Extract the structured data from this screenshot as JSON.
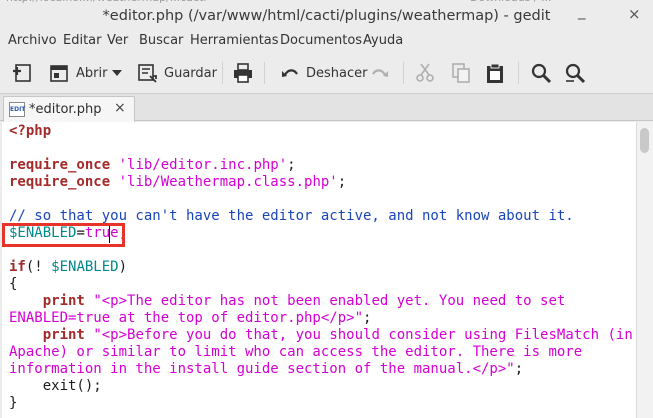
{
  "window": {
    "title": "*editor.php (/var/www/html/cacti/plugins/weathermap) - gedit",
    "minimize": "_",
    "close": "×"
  },
  "menubar": {
    "items": [
      "Archivo",
      "Editar",
      "Ver",
      "Buscar",
      "Herramientas",
      "Documentos",
      "Ayuda"
    ]
  },
  "toolbar": {
    "open_label": "Abrir",
    "save_label": "Guardar",
    "undo_label": "Deshacer"
  },
  "tab": {
    "label": "*editor.php",
    "icon_text": "EDIT",
    "close": "×"
  },
  "editor": {
    "lines": [
      [
        {
          "t": "<?php",
          "c": "kw"
        }
      ],
      [],
      [
        {
          "t": "require_once",
          "c": "kw"
        },
        {
          "t": " ",
          "c": "txt"
        },
        {
          "t": "'lib/editor.inc.php'",
          "c": "str"
        },
        {
          "t": ";",
          "c": "txt"
        }
      ],
      [
        {
          "t": "require_once",
          "c": "kw"
        },
        {
          "t": " ",
          "c": "txt"
        },
        {
          "t": "'lib/Weathermap.class.php'",
          "c": "str"
        },
        {
          "t": ";",
          "c": "txt"
        }
      ],
      [],
      [
        {
          "t": "// so that you can't have the editor active, and not know about it.",
          "c": "cmt"
        }
      ],
      [
        {
          "t": "$ENABLED",
          "c": "var"
        },
        {
          "t": "=",
          "c": "txt"
        },
        {
          "t": "true",
          "c": "str"
        },
        {
          "t": ";",
          "c": "txt"
        }
      ],
      [],
      [
        {
          "t": "if",
          "c": "kw"
        },
        {
          "t": "(! ",
          "c": "txt"
        },
        {
          "t": "$ENABLED",
          "c": "var"
        },
        {
          "t": ")",
          "c": "txt"
        }
      ],
      [
        {
          "t": "{",
          "c": "txt"
        }
      ],
      [
        {
          "t": "    ",
          "c": "txt"
        },
        {
          "t": "print",
          "c": "kw"
        },
        {
          "t": " ",
          "c": "txt"
        },
        {
          "t": "\"<p>The editor has not been enabled yet. You need to set",
          "c": "str"
        }
      ],
      [
        {
          "t": "ENABLED=true at the top of editor.php</p>\"",
          "c": "str"
        },
        {
          "t": ";",
          "c": "txt"
        }
      ],
      [
        {
          "t": "    ",
          "c": "txt"
        },
        {
          "t": "print",
          "c": "kw"
        },
        {
          "t": " ",
          "c": "txt"
        },
        {
          "t": "\"<p>Before you do that, you should consider using FilesMatch (in",
          "c": "str"
        }
      ],
      [
        {
          "t": "Apache) or similar to limit who can access the editor. There is more",
          "c": "str"
        }
      ],
      [
        {
          "t": "information in the install guide section of the manual.</p>\"",
          "c": "str"
        },
        {
          "t": ";",
          "c": "txt"
        }
      ],
      [
        {
          "t": "    exit();",
          "c": "txt"
        }
      ],
      [
        {
          "t": "}",
          "c": "txt"
        }
      ]
    ]
  }
}
